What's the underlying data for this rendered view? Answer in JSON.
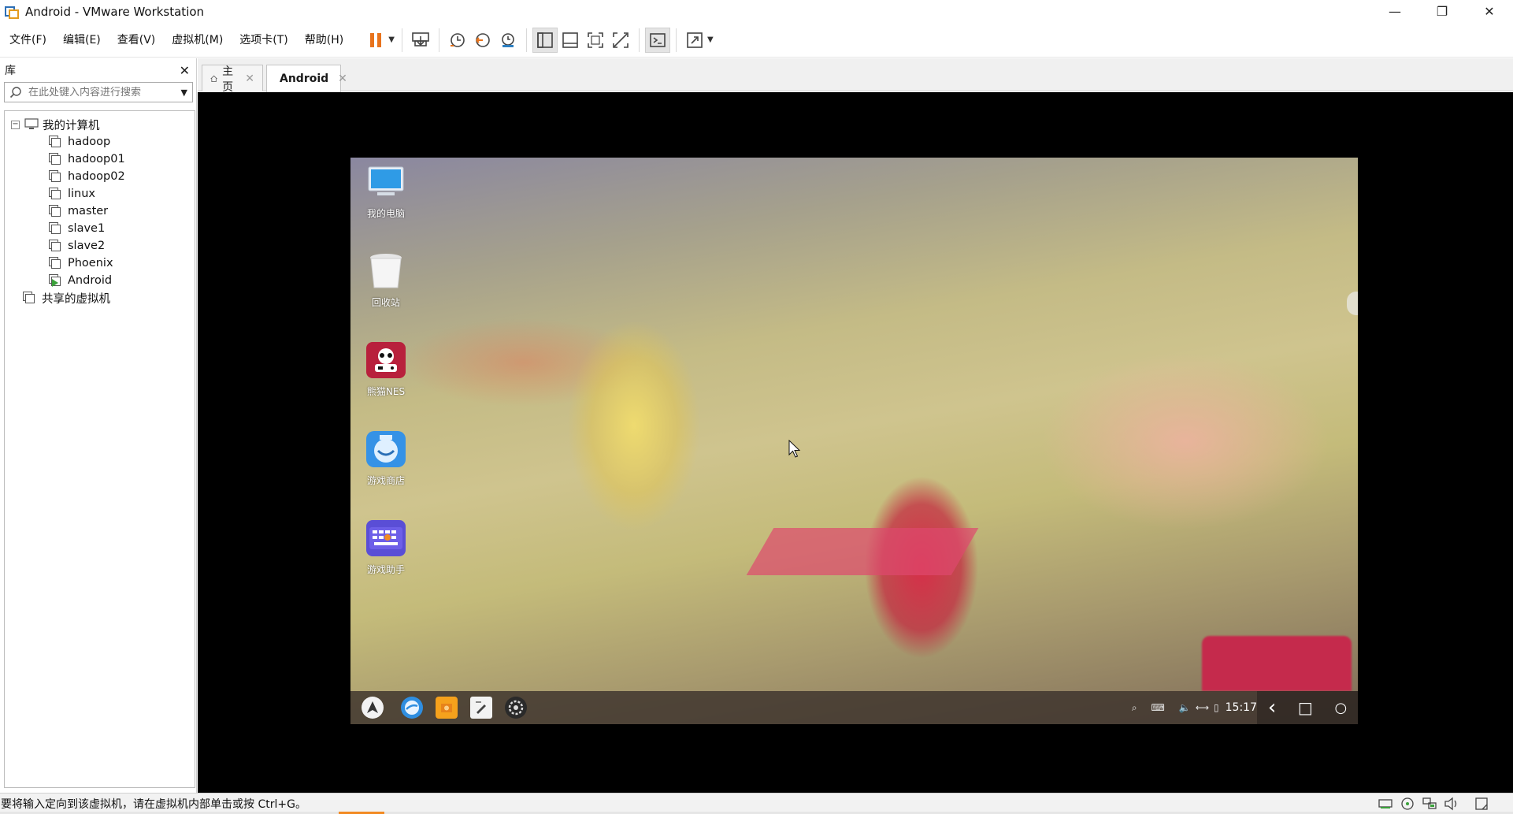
{
  "window": {
    "title": "Android - VMware Workstation",
    "minimize_glyph": "—",
    "maximize_glyph": "❐",
    "close_glyph": "✕"
  },
  "menu": [
    {
      "label": "文件(F)"
    },
    {
      "label": "编辑(E)"
    },
    {
      "label": "查看(V)"
    },
    {
      "label": "虚拟机(M)"
    },
    {
      "label": "选项卡(T)"
    },
    {
      "label": "帮助(H)"
    }
  ],
  "toolbar": {
    "icons": [
      "pause-icon",
      "send-keys-icon",
      "snapshot-icon",
      "revert-snapshot-icon",
      "snapshot-manager-icon",
      "show-library-icon",
      "show-thumbnail-icon",
      "fullscreen-icon",
      "unity-icon",
      "console-view-icon",
      "stretch-icon"
    ],
    "pause_color": "#e8731c"
  },
  "library": {
    "title": "库",
    "close_glyph": "✕",
    "search_placeholder": "在此处键入内容进行搜索",
    "tree": {
      "root_label": "我的计算机",
      "root_expander": "−",
      "vms": [
        {
          "name": "hadoop",
          "running": false
        },
        {
          "name": "hadoop01",
          "running": false
        },
        {
          "name": "hadoop02",
          "running": false
        },
        {
          "name": "linux",
          "running": false
        },
        {
          "name": "master",
          "running": false
        },
        {
          "name": "slave1",
          "running": false
        },
        {
          "name": "slave2",
          "running": false
        },
        {
          "name": "Phoenix",
          "running": false
        },
        {
          "name": "Android",
          "running": true
        }
      ],
      "shared_label": "共享的虚拟机"
    }
  },
  "tabs": [
    {
      "label": "主页",
      "active": false
    },
    {
      "label": "Android",
      "active": true
    }
  ],
  "tab_close_glyph": "✕",
  "android": {
    "desktop_icons": [
      {
        "label": "我的电脑",
        "icon": "computer-icon"
      },
      {
        "label": "回收站",
        "icon": "trash-icon"
      },
      {
        "label": "熊猫NES",
        "icon": "nes-emulator-icon"
      },
      {
        "label": "游戏商店",
        "icon": "game-store-icon"
      },
      {
        "label": "游戏助手",
        "icon": "game-assistant-icon"
      }
    ],
    "taskbar_apps": [
      "launcher-icon",
      "browser-icon",
      "file-manager-icon",
      "editor-icon",
      "settings-icon"
    ],
    "tray": {
      "search_glyph": "⌕",
      "keyboard_glyph": "⌨",
      "volume_glyph": "🔈",
      "network_glyph": "⟷",
      "battery_glyph": "▯",
      "clock": "15:17"
    },
    "nav": {
      "back_glyph": "‹",
      "recents_glyph": "□",
      "home_glyph": "○"
    }
  },
  "statusbar": {
    "message": "要将输入定向到该虚拟机，请在虚拟机内部单击或按 Ctrl+G。",
    "icons": [
      "hard-disk-icon",
      "cd-rom-icon",
      "network-adapter-icon",
      "sound-icon",
      "message-icon"
    ],
    "progress_fraction": 0.03
  },
  "colors": {
    "accent_orange": "#e8731c",
    "console_bg": "#000000",
    "status_progress": "#f28a22"
  }
}
